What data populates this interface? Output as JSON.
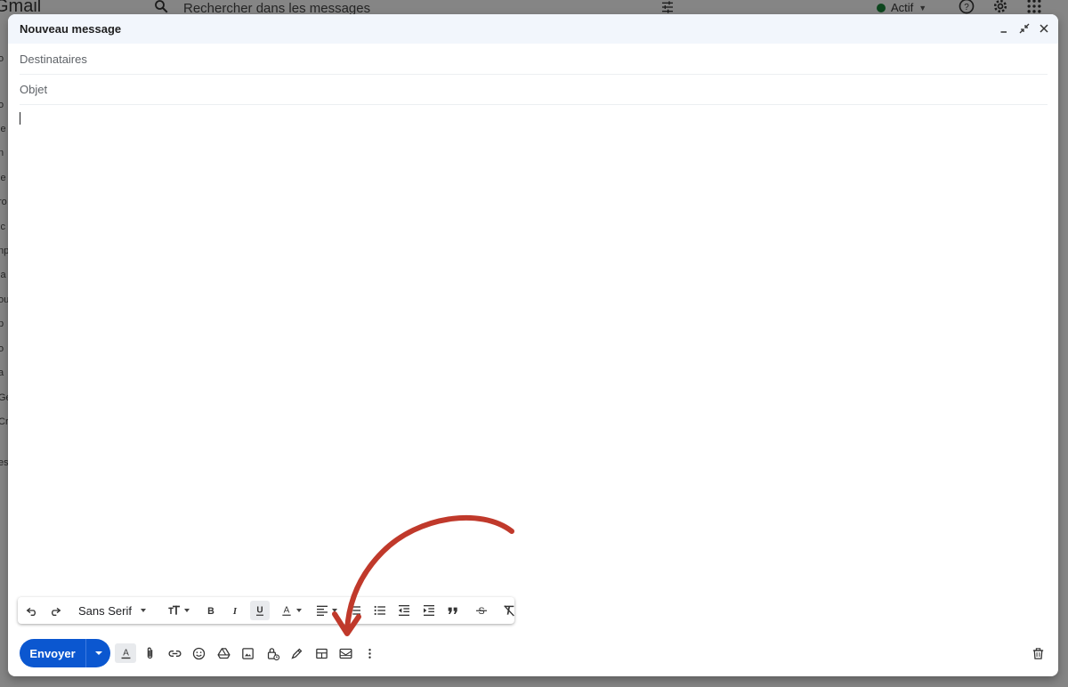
{
  "background": {
    "logo": "Gmail",
    "search_placeholder": "Rechercher dans les messages",
    "status_label": "Actif",
    "status_color": "#188038",
    "sidebar_fragments": [
      "o",
      "o",
      "le",
      "n",
      "le",
      "ro",
      "lc",
      "np",
      "la",
      "ou",
      "p",
      "o",
      "a",
      "Gé",
      "Cr",
      "es"
    ],
    "icons": [
      "search-icon",
      "tune-icon",
      "help-icon",
      "gear-icon",
      "apps-icon"
    ]
  },
  "compose": {
    "title": "Nouveau message",
    "header_icons": [
      "minimize-icon",
      "exit-fullscreen-icon",
      "close-icon"
    ],
    "recipients_placeholder": "Destinataires",
    "subject_placeholder": "Objet",
    "body_text": ""
  },
  "format_toolbar": {
    "font_label": "Sans Serif",
    "icons": [
      "undo-icon",
      "redo-icon",
      "text-size-icon",
      "bold-icon",
      "italic-icon",
      "underline-icon",
      "text-color-icon",
      "align-icon",
      "numbered-list-icon",
      "bulleted-list-icon",
      "indent-less-icon",
      "indent-more-icon",
      "quote-icon",
      "strikethrough-icon",
      "clear-formatting-icon"
    ],
    "active": "underline-icon"
  },
  "bottom_bar": {
    "send_label": "Envoyer",
    "accent_color": "#0b57d0",
    "icons": [
      "formatting-options-icon",
      "attach-icon",
      "link-icon",
      "emoji-icon",
      "drive-icon",
      "photo-icon",
      "confidential-mode-icon",
      "signature-icon",
      "layouts-icon",
      "template-email-icon",
      "more-options-icon",
      "trash-icon"
    ]
  },
  "annotation": {
    "arrow_color": "#c0392b",
    "points_to": "template-email-icon"
  }
}
